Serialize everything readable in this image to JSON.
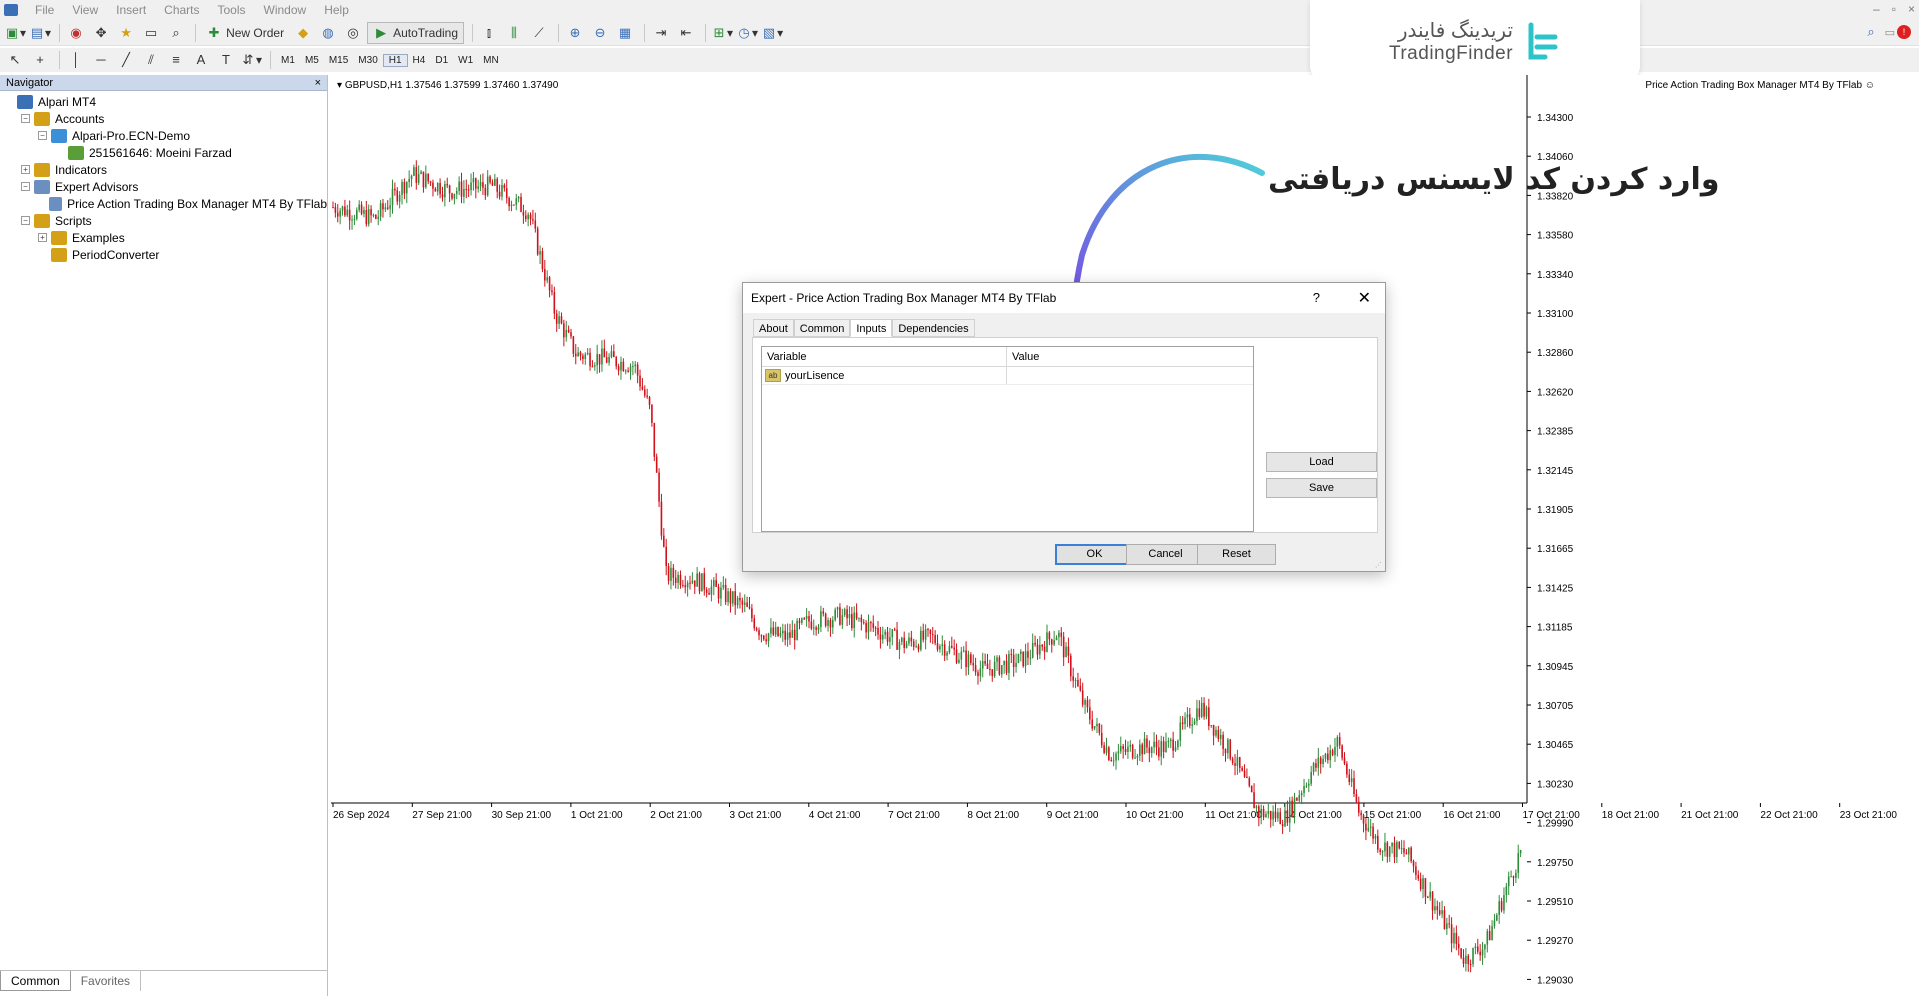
{
  "menu": {
    "items": [
      "File",
      "View",
      "Insert",
      "Charts",
      "Tools",
      "Window",
      "Help"
    ]
  },
  "toolbar": {
    "new_order_label": "New Order",
    "autotrading_label": "AutoTrading",
    "timeframes": [
      "M1",
      "M5",
      "M15",
      "M30",
      "H1",
      "H4",
      "D1",
      "W1",
      "MN"
    ]
  },
  "logo": {
    "fa": "تریدینگ فایندر",
    "en": "TradingFinder",
    "accent": "#2cc4c9"
  },
  "navigator": {
    "title": "Navigator",
    "close": "×",
    "tree": [
      {
        "label": "Alpari MT4",
        "level": 0,
        "exp": "",
        "icon": "computer-icon"
      },
      {
        "label": "Accounts",
        "level": 1,
        "exp": "−",
        "icon": "accounts-icon"
      },
      {
        "label": "Alpari-Pro.ECN-Demo",
        "level": 2,
        "exp": "−",
        "icon": "server-icon"
      },
      {
        "label": "251561646: Moeini Farzad",
        "level": 3,
        "exp": "",
        "icon": "user-icon"
      },
      {
        "label": "Indicators",
        "level": 1,
        "exp": "+",
        "icon": "indicators-icon"
      },
      {
        "label": "Expert Advisors",
        "level": 1,
        "exp": "−",
        "icon": "experts-icon"
      },
      {
        "label": "Price Action Trading Box Manager MT4 By TFlab",
        "level": 2,
        "exp": "",
        "icon": "expert-icon"
      },
      {
        "label": "Scripts",
        "level": 1,
        "exp": "−",
        "icon": "scripts-icon"
      },
      {
        "label": "Examples",
        "level": 2,
        "exp": "+",
        "icon": "folder-icon"
      },
      {
        "label": "PeriodConverter",
        "level": 2,
        "exp": "",
        "icon": "script-icon"
      }
    ],
    "tabs": [
      "Common",
      "Favorites"
    ]
  },
  "chart": {
    "header": "GBPUSD,H1  1.37546 1.37599 1.37460 1.37490",
    "ea_label": "Price Action Trading Box Manager MT4 By TFlab",
    "ea_face": "☺",
    "up_color": "#2e8b3a",
    "down_color": "#d0101a"
  },
  "chart_data": {
    "type": "candlestick",
    "symbol": "GBPUSD",
    "timeframe": "H1",
    "y_ticks": [
      "1.34300",
      "1.34060",
      "1.33820",
      "1.33580",
      "1.33340",
      "1.33100",
      "1.32860",
      "1.32620",
      "1.32385",
      "1.32145",
      "1.31905",
      "1.31665",
      "1.31425",
      "1.31185",
      "1.30945",
      "1.30705",
      "1.30465",
      "1.30230",
      "1.29990",
      "1.29750",
      "1.29510",
      "1.29270",
      "1.29030"
    ],
    "x_ticks": [
      "26 Sep 2024",
      "27 Sep 21:00",
      "30 Sep 21:00",
      "1 Oct 21:00",
      "2 Oct 21:00",
      "3 Oct 21:00",
      "4 Oct 21:00",
      "7 Oct 21:00",
      "8 Oct 21:00",
      "9 Oct 21:00",
      "10 Oct 21:00",
      "11 Oct 21:00",
      "14 Oct 21:00",
      "15 Oct 21:00",
      "16 Oct 21:00",
      "17 Oct 21:00",
      "18 Oct 21:00",
      "21 Oct 21:00",
      "22 Oct 21:00",
      "23 Oct 21:00"
    ],
    "ylim": [
      1.2895,
      1.344
    ],
    "close_path": [
      [
        0,
        1.3375
      ],
      [
        0.8,
        1.3368
      ],
      [
        1.5,
        1.3395
      ],
      [
        2.2,
        1.3385
      ],
      [
        3.0,
        1.3388
      ],
      [
        3.7,
        1.3372
      ],
      [
        4.2,
        1.331
      ],
      [
        4.6,
        1.3285
      ],
      [
        5.2,
        1.3282
      ],
      [
        5.7,
        1.3278
      ],
      [
        6.0,
        1.325
      ],
      [
        6.3,
        1.315
      ],
      [
        6.8,
        1.3148
      ],
      [
        7.3,
        1.314
      ],
      [
        7.8,
        1.313
      ],
      [
        8.1,
        1.3115
      ],
      [
        8.6,
        1.3112
      ],
      [
        9.0,
        1.3122
      ],
      [
        9.6,
        1.3125
      ],
      [
        10.2,
        1.3118
      ],
      [
        10.8,
        1.3108
      ],
      [
        11.3,
        1.3112
      ],
      [
        11.8,
        1.3102
      ],
      [
        12.3,
        1.3092
      ],
      [
        13.0,
        1.3098
      ],
      [
        13.7,
        1.3115
      ],
      [
        14.2,
        1.307
      ],
      [
        14.7,
        1.304
      ],
      [
        15.3,
        1.3045
      ],
      [
        15.8,
        1.3045
      ],
      [
        16.4,
        1.307
      ],
      [
        17.0,
        1.304
      ],
      [
        17.5,
        1.3005
      ],
      [
        18.0,
        1.3002
      ],
      [
        18.5,
        1.303
      ],
      [
        19.0,
        1.3048
      ],
      [
        19.4,
        1.3005
      ],
      [
        19.8,
        1.2985
      ],
      [
        20.3,
        1.298
      ],
      [
        20.8,
        1.295
      ],
      [
        21.4,
        1.2915
      ],
      [
        21.8,
        1.2925
      ],
      [
        22.2,
        1.296
      ],
      [
        22.5,
        1.2985
      ]
    ]
  },
  "annotation": {
    "text": "وارد کردن کد لایسنس دریافتی",
    "arrow_color": "#7b3fe4"
  },
  "dialog": {
    "title": "Expert - Price Action Trading Box Manager MT4 By TFlab",
    "help": "?",
    "close": "✕",
    "tabs": [
      "About",
      "Common",
      "Inputs",
      "Dependencies"
    ],
    "active_tab": "Inputs",
    "columns": [
      "Variable",
      "Value"
    ],
    "rows": [
      {
        "type_icon": "ab",
        "variable": "yourLisence",
        "value": ""
      }
    ],
    "load_label": "Load",
    "save_label": "Save",
    "ok_label": "OK",
    "cancel_label": "Cancel",
    "reset_label": "Reset"
  }
}
